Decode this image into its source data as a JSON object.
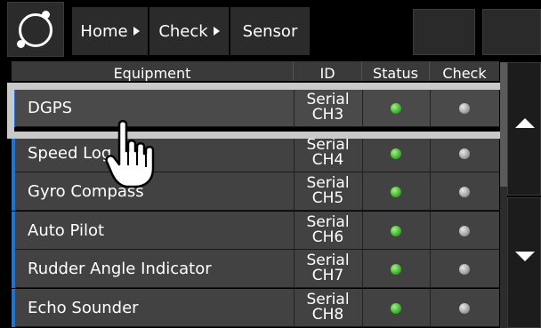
{
  "breadcrumb": {
    "items": [
      {
        "label": "Home"
      },
      {
        "label": "Check"
      },
      {
        "label": "Sensor"
      }
    ]
  },
  "table": {
    "columns": [
      "Equipment",
      "ID",
      "Status",
      "Check"
    ],
    "rows": [
      {
        "name": "DGPS",
        "id_line1": "Serial",
        "id_line2": "CH3",
        "status": "ok",
        "check": "idle"
      },
      {
        "name": "Speed Log",
        "id_line1": "Serial",
        "id_line2": "CH4",
        "status": "ok",
        "check": "idle"
      },
      {
        "name": "Gyro Compass",
        "id_line1": "Serial",
        "id_line2": "CH5",
        "status": "ok",
        "check": "idle"
      },
      {
        "name": "Auto Pilot",
        "id_line1": "Serial",
        "id_line2": "CH6",
        "status": "ok",
        "check": "idle"
      },
      {
        "name": "Rudder Angle Indicator",
        "id_line1": "Serial",
        "id_line2": "CH7",
        "status": "ok",
        "check": "idle"
      },
      {
        "name": "Echo Sounder",
        "id_line1": "Serial",
        "id_line2": "CH8",
        "status": "ok",
        "check": "idle"
      }
    ],
    "selected_row": "DGPS"
  },
  "colors": {
    "accent": "#1e74d6",
    "status_ok": "#3db52a",
    "check_idle": "#a0a0a0",
    "highlight": "#c9c9c9"
  },
  "icons": {
    "logo": "ring-logo-icon",
    "breadcrumb_separator": "triangle-right-icon",
    "scroll_up": "arrow-up-icon",
    "scroll_down": "arrow-down-icon",
    "pointer": "hand-pointer-icon"
  }
}
